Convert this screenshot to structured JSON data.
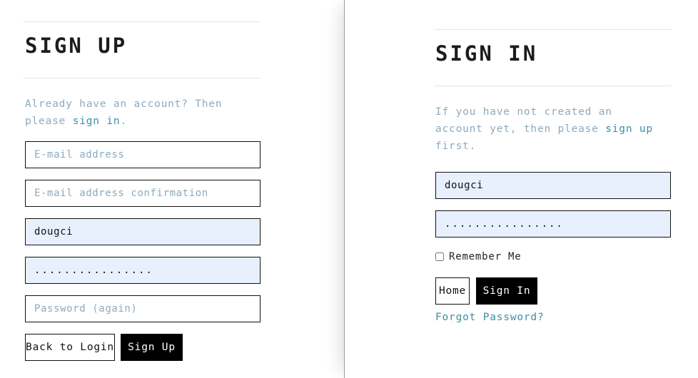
{
  "signup": {
    "title": "SIGN UP",
    "intro_text": "Already have an account? Then please ",
    "intro_link": "sign in",
    "intro_end": ".",
    "email_placeholder": "E-mail address",
    "email_confirm_placeholder": "E-mail address confirmation",
    "username_value": "dougci",
    "password_value": "................",
    "password_again_placeholder": "Password (again)",
    "back_label": "Back to Login",
    "submit_label": "Sign Up"
  },
  "signin": {
    "title": "SIGN IN",
    "intro_text": "If you have not created an account yet, then please ",
    "intro_link": "sign up",
    "intro_end": " first.",
    "username_value": "dougci",
    "password_value": "................",
    "remember_label": "Remember Me",
    "home_label": "Home",
    "submit_label": "Sign In",
    "forgot_label": "Forgot Password?"
  }
}
